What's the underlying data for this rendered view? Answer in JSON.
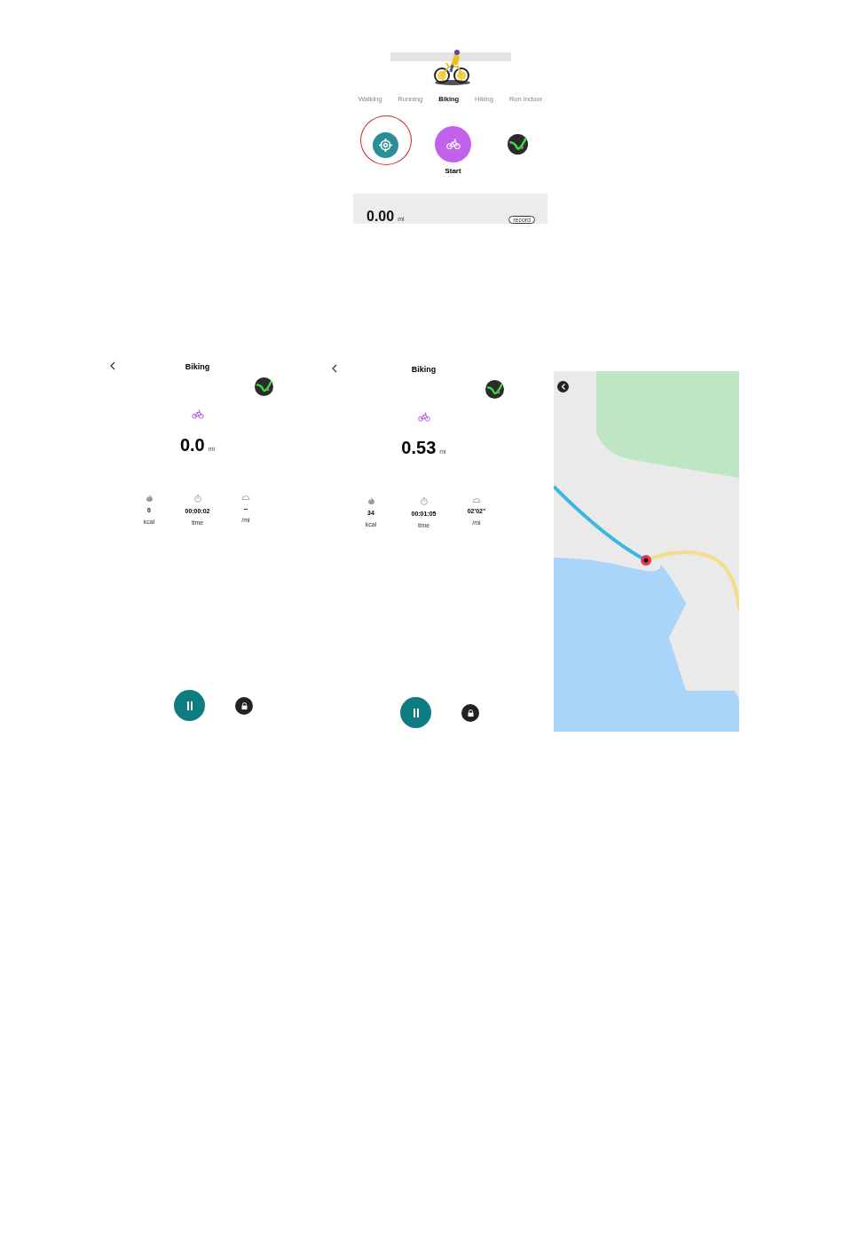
{
  "mode_screen": {
    "tabs": [
      {
        "label": "Walking",
        "selected": false
      },
      {
        "label": "Running",
        "selected": false
      },
      {
        "label": "Biking",
        "selected": true
      },
      {
        "label": "Hiking",
        "selected": false
      },
      {
        "label": "Run Indoor",
        "selected": false
      }
    ],
    "buttons": [
      {
        "kind": "location",
        "highlighted": true
      },
      {
        "kind": "start",
        "highlighted": false
      },
      {
        "kind": "map",
        "highlighted": false
      }
    ],
    "start_label": "Start",
    "distance": "0.00",
    "unit": "mi",
    "record_button": "record"
  },
  "workout_screens": [
    {
      "title": "Biking",
      "distance": "0.0",
      "unit": "mi",
      "stats": [
        {
          "kind": "calories",
          "value": "0",
          "label": "kcal"
        },
        {
          "kind": "time",
          "value": "00:00:02",
          "label": "time"
        },
        {
          "kind": "pace",
          "value": "--",
          "label": "/mi"
        }
      ]
    },
    {
      "title": "Biking",
      "distance": "0.53",
      "unit": "mi",
      "stats": [
        {
          "kind": "calories",
          "value": "34",
          "label": "kcal"
        },
        {
          "kind": "time",
          "value": "00:01:05",
          "label": "time"
        },
        {
          "kind": "pace",
          "value": "02'02\"",
          "label": "/mi"
        }
      ]
    }
  ]
}
